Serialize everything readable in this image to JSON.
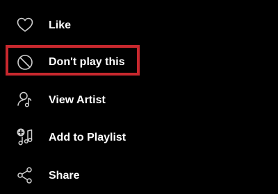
{
  "menu": {
    "items": [
      {
        "label": "Like",
        "icon": "heart-icon"
      },
      {
        "label": "Don't play this",
        "icon": "block-icon"
      },
      {
        "label": "View Artist",
        "icon": "artist-icon"
      },
      {
        "label": "Add to Playlist",
        "icon": "add-to-playlist-icon"
      },
      {
        "label": "Share",
        "icon": "share-icon"
      }
    ]
  },
  "highlight": {
    "color": "#c8282e"
  },
  "colors": {
    "background": "#000000",
    "text": "#ffffff",
    "icon": "#b3b3b3"
  }
}
